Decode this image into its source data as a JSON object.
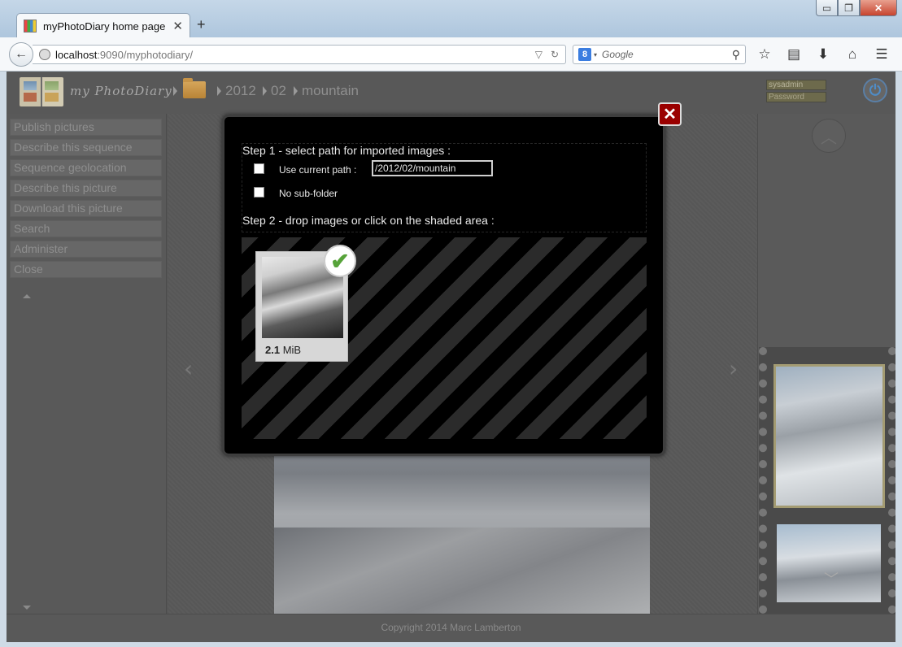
{
  "browser": {
    "tab_title": "myPhotoDiary home page",
    "tab_close": "✕",
    "new_tab": "+",
    "url_host": "localhost",
    "url_rest": ":9090/myphotodiary/",
    "search_engine": "8",
    "search_placeholder": "Google",
    "win_min": "▭",
    "win_max": "❐",
    "win_close": "✕"
  },
  "header": {
    "logo_text": "my PhotoDiary",
    "breadcrumb": [
      "2012",
      "02",
      "mountain"
    ],
    "login_user": "sysadmin",
    "login_pass": "Password"
  },
  "sidebar": {
    "items": [
      "Publish pictures",
      "Describe this sequence",
      "Sequence geolocation",
      "Describe this picture",
      "Download this picture",
      "Search",
      "Administer",
      "Close"
    ]
  },
  "viewer": {
    "prev": "‹",
    "next": "›"
  },
  "rightpanel": {
    "up": "︿",
    "down": "﹀"
  },
  "footer": {
    "copyright": "Copyright 2014 Marc Lamberton"
  },
  "modal": {
    "close": "✕",
    "step1": "Step 1 - select path for imported images :",
    "use_current_path_label": "Use current path :",
    "path_value": "/2012/02/mountain",
    "no_subfolder_label": "No sub-folder",
    "step2": "Step 2 - drop images or click on the shaded area :",
    "file_size_value": "2.1",
    "file_size_unit": "MiB",
    "check": "✔"
  },
  "icons": {
    "back": "back-arrow-icon",
    "reload": "reload-icon",
    "search": "search-icon",
    "bookmark": "star-icon",
    "reading": "clipboard-icon",
    "download": "download-icon",
    "home": "home-icon",
    "menu": "hamburger-menu-icon",
    "power": "power-icon",
    "folder": "folder-icon"
  },
  "colors": {
    "accent_close": "#9a0000",
    "check_green": "#57a33a",
    "power_blue": "#4f8cc6"
  }
}
